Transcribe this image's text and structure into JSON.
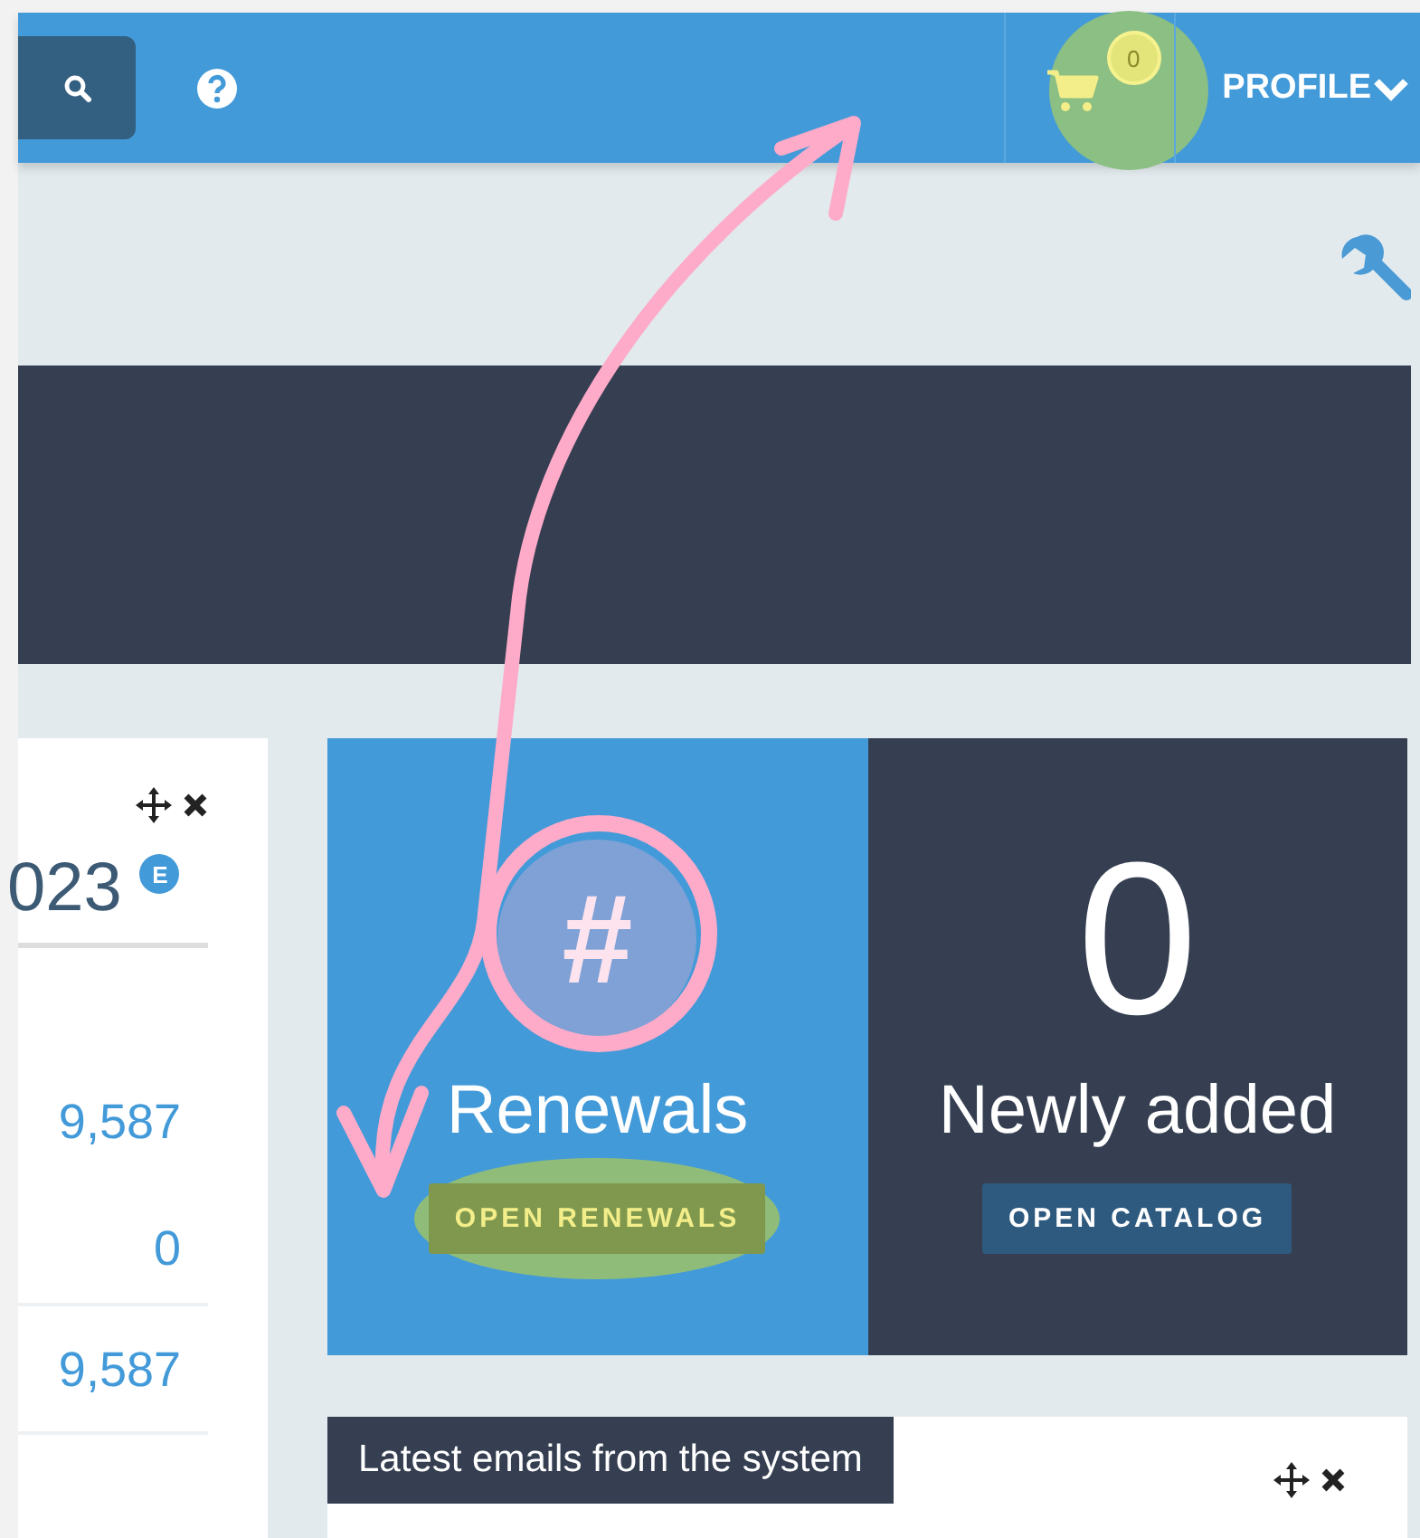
{
  "topbar": {
    "cart": {
      "count": "0",
      "highlighted": true
    },
    "profile": "PROFILE"
  },
  "left_card": {
    "title": "023",
    "badge": "E",
    "groups": [
      [
        "9,587",
        "0"
      ],
      [
        "9,587"
      ]
    ]
  },
  "tiles": [
    {
      "kind": "icon",
      "glyph": "#",
      "title": "Renewals",
      "button": "OPEN RENEWALS",
      "highlighted": true
    },
    {
      "kind": "number",
      "number": "0",
      "title": "Newly added",
      "button": "OPEN CATALOG",
      "highlighted": false
    }
  ],
  "emails_panel": {
    "title": "Latest emails from the system"
  }
}
